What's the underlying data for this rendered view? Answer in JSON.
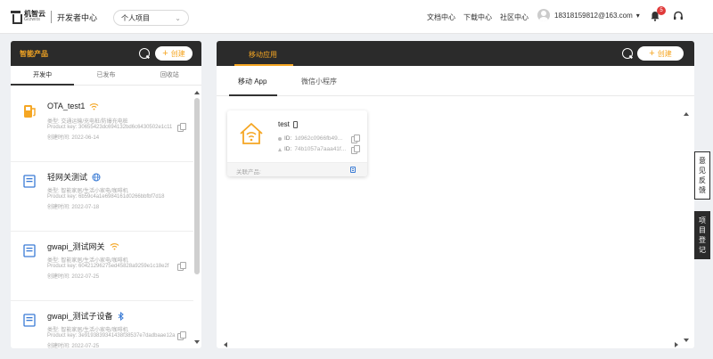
{
  "header": {
    "logo_cn": "机智云",
    "logo_en": "Gizwits",
    "subtitle": "开发者中心",
    "project_select": "个人项目",
    "nav": [
      "文档中心",
      "下载中心",
      "社区中心"
    ],
    "user_email": "18318159812@163.com",
    "user_caret": "▾",
    "notification_count": "5"
  },
  "left_panel": {
    "title": "智能产品",
    "create_label": "创建",
    "tabs": [
      "开发中",
      "已发布",
      "回收站"
    ],
    "products": [
      {
        "name": "OTA_test1",
        "type": "类型: 交通运输/充电桩/防爆充电桩",
        "key": "Product key: 30655423dc694132bd6c6430502e1c11",
        "created": "创建时间: 2022-06-14"
      },
      {
        "name": "轻网关测试",
        "type": "类型: 智能家居/生活小家电/咖啡机",
        "key": "Product key: 6b59c4a1e6984161d0266bbfbf7d18",
        "created": "创建时间: 2022-07-18"
      },
      {
        "name": "gwapi_测试网关",
        "type": "类型: 智能家居/生活小家电/咖啡机",
        "key": "Product key: 60421296275ed45828a9259e1c18e2f",
        "created": "创建时间: 2022-07-25"
      },
      {
        "name": "gwapi_测试子设备",
        "type": "类型: 智能家居/生活小家电/咖啡机",
        "key": "Product key: 3e9193839341438f38537e7dadbaae12a",
        "created": "创建时间: 2022-07-25"
      }
    ]
  },
  "right_panel": {
    "active_tab": "移动应用",
    "create_label": "创建",
    "subtabs": [
      "移动 App",
      "微信小程序"
    ],
    "app": {
      "name": "test",
      "id1_label": "ID:",
      "id1_value": "1d962c0966fb49...",
      "id2_label": "ID:",
      "id2_value": "74b1057a7aaa41f...",
      "related_label": "关联产品:"
    }
  },
  "side_tabs": {
    "feedback": "意见反馈",
    "register": "项目登记"
  },
  "colors": {
    "accent": "#f5a623",
    "dark_header": "#2b2b2b",
    "badge": "#e03a3a",
    "link_blue": "#3a7bd5"
  }
}
